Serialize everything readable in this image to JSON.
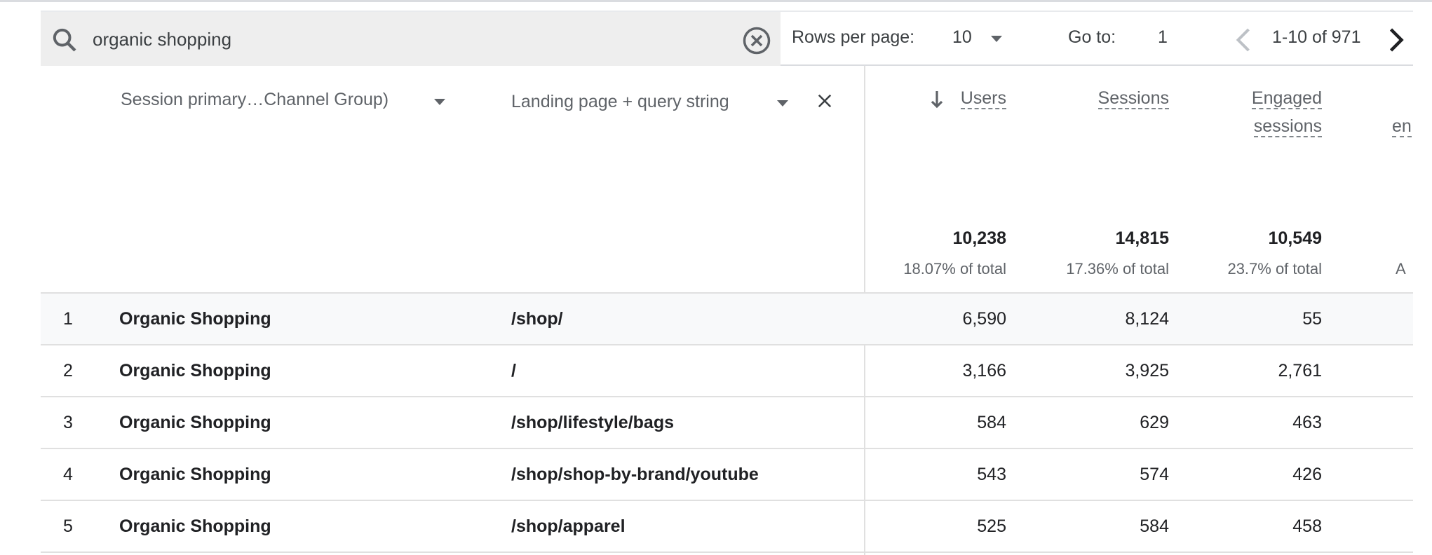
{
  "search": {
    "value": "organic shopping",
    "icon": "search-icon",
    "clear_icon": "cancel-circle-icon"
  },
  "pagination": {
    "rows_per_page_label": "Rows per page:",
    "rows_per_page": "10",
    "goto_label": "Go to:",
    "goto_value": "1",
    "range": "1-10 of 971"
  },
  "columns": {
    "dim1": "Session primary…Channel Group)",
    "dim2": "Landing page + query string",
    "metrics": [
      {
        "label": "Users",
        "sorted": "descending"
      },
      {
        "label": "Sessions"
      },
      {
        "label": "Engaged sessions",
        "line1": "Engaged",
        "line2": "sessions"
      },
      {
        "label": "en"
      }
    ]
  },
  "totals": [
    {
      "value": "10,238",
      "pct": "18.07% of total"
    },
    {
      "value": "14,815",
      "pct": "17.36% of total"
    },
    {
      "value": "10,549",
      "pct": "23.7% of total"
    },
    {
      "pct": "A"
    }
  ],
  "rows": [
    {
      "n": "1",
      "channel": "Organic Shopping",
      "page": "/shop/",
      "users": "6,590",
      "sessions": "8,124",
      "engaged": "55"
    },
    {
      "n": "2",
      "channel": "Organic Shopping",
      "page": "/",
      "users": "3,166",
      "sessions": "3,925",
      "engaged": "2,761"
    },
    {
      "n": "3",
      "channel": "Organic Shopping",
      "page": "/shop/lifestyle/bags",
      "users": "584",
      "sessions": "629",
      "engaged": "463"
    },
    {
      "n": "4",
      "channel": "Organic Shopping",
      "page": "/shop/shop-by-brand/youtube",
      "users": "543",
      "sessions": "574",
      "engaged": "426"
    },
    {
      "n": "5",
      "channel": "Organic Shopping",
      "page": "/shop/apparel",
      "users": "525",
      "sessions": "584",
      "engaged": "458"
    }
  ]
}
